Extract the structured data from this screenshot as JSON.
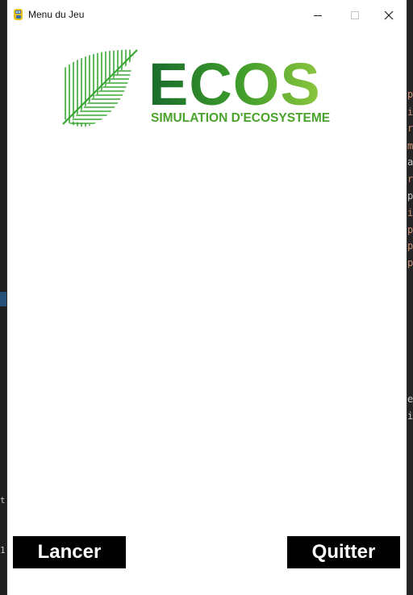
{
  "window": {
    "title": "Menu du Jeu"
  },
  "logo": {
    "name": "ECOS",
    "tagline": "SIMULATION D'ECOSYSTEME",
    "colors": {
      "dark": "#1a6b2c",
      "mid": "#3a9a2a",
      "light": "#8dc63f",
      "tagline": "#4aa32a"
    }
  },
  "buttons": {
    "launch": "Lancer",
    "quit": "Quitter"
  },
  "background_code": {
    "right_chars": [
      "p",
      "i",
      "r",
      "m",
      "a",
      "r",
      "p",
      "i",
      "p",
      "p",
      "p"
    ],
    "right_chars2": [
      "e",
      "i"
    ],
    "bottom_left": [
      "t",
      "1"
    ]
  }
}
